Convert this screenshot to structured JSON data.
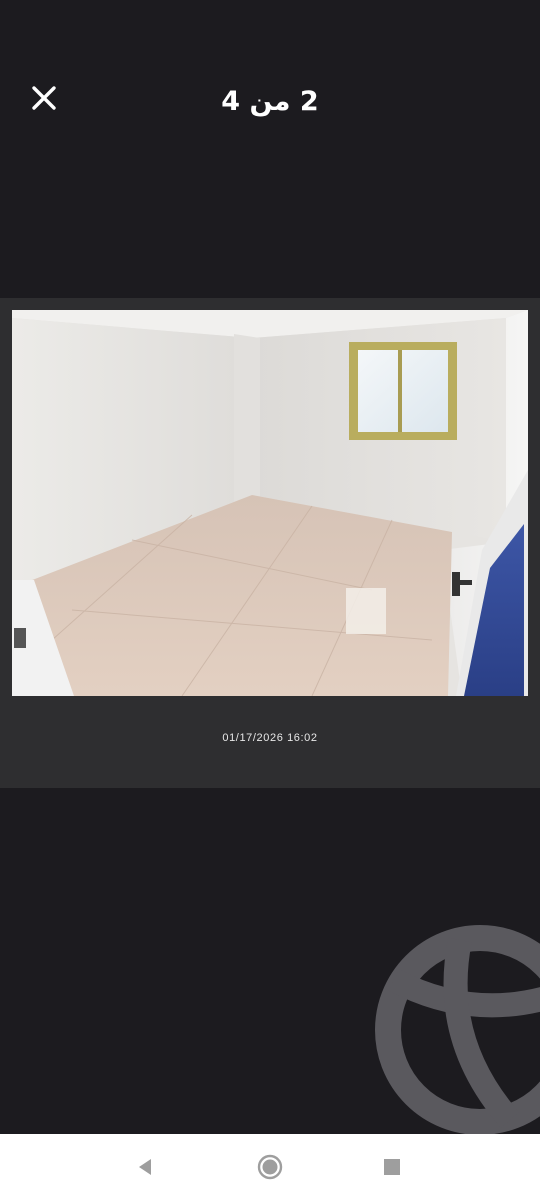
{
  "viewer": {
    "counter_text": "2 من 4",
    "photo": {
      "timestamp": "01/17/2026 16:02",
      "alt": "empty room with marble floor"
    }
  },
  "icons": {
    "close": "close-icon",
    "back": "back-triangle-icon",
    "home": "home-circle-icon",
    "recents": "recents-square-icon",
    "watermark": "globe-watermark-icon"
  },
  "colors": {
    "background": "#1c1b1f",
    "card": "#2e2e30",
    "text": "#ffffff",
    "navbar": "#ffffff"
  }
}
